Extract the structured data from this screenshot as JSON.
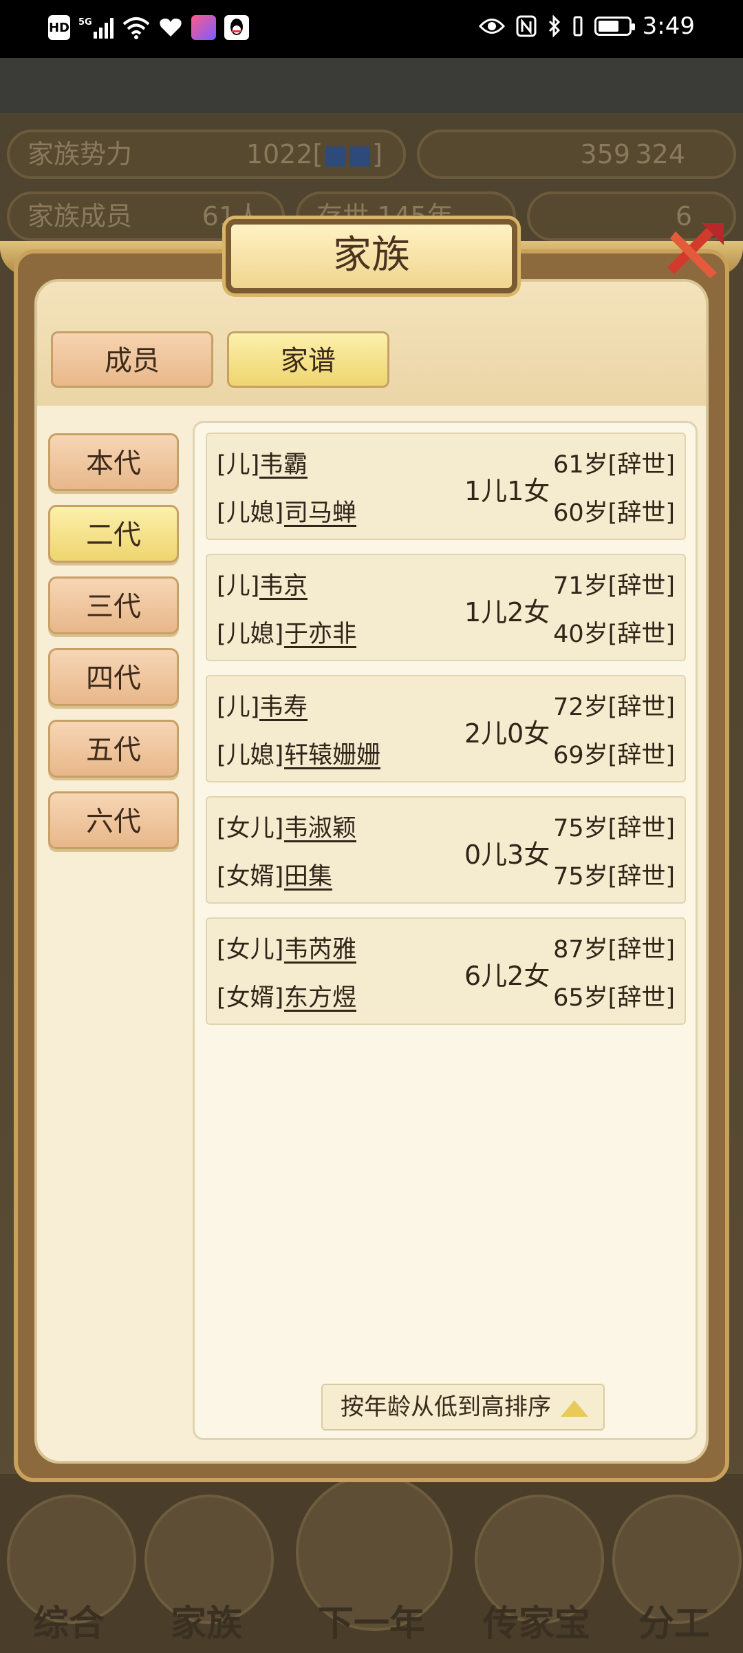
{
  "status_bar": {
    "left_icons": [
      "hd-icon",
      "signal-5g-icon",
      "wifi-icon",
      "heart-icon",
      "app-icon",
      "qq-icon"
    ],
    "hd_label": "HD",
    "net_label": "5G",
    "battery_level": 0.7,
    "time": "3:49"
  },
  "background_game": {
    "stat_power_label": "家族势力",
    "stat_power_value": "1022[",
    "stat_power_close": "]",
    "stat_resources": "359",
    "stat_resources2": "324",
    "stat_members_label": "家族成员",
    "stat_members_value": "61人",
    "stat_existence": "存世 145年",
    "stat_gold": "6",
    "nav_items": [
      "综合",
      "家族",
      "下一年",
      "传家宝",
      "分工"
    ]
  },
  "dialog": {
    "title": "家族",
    "tabs": [
      {
        "label": "成员",
        "active": false
      },
      {
        "label": "家谱",
        "active": true
      }
    ],
    "generations": [
      {
        "label": "本代",
        "active": false
      },
      {
        "label": "二代",
        "active": true
      },
      {
        "label": "三代",
        "active": false
      },
      {
        "label": "四代",
        "active": false
      },
      {
        "label": "五代",
        "active": false
      },
      {
        "label": "六代",
        "active": false
      }
    ],
    "families": [
      {
        "role1": "[儿]",
        "name1": "韦霸",
        "role2": "[儿媳]",
        "name2": "司马蝉",
        "children": "1儿1女",
        "age1": "61岁[辞世]",
        "age2": "60岁[辞世]"
      },
      {
        "role1": "[儿]",
        "name1": "韦京",
        "role2": "[儿媳]",
        "name2": "于亦非",
        "children": "1儿2女",
        "age1": "71岁[辞世]",
        "age2": "40岁[辞世]"
      },
      {
        "role1": "[儿]",
        "name1": "韦寿",
        "role2": "[儿媳]",
        "name2": "轩辕姗姗",
        "children": "2儿0女",
        "age1": "72岁[辞世]",
        "age2": "69岁[辞世]"
      },
      {
        "role1": "[女儿]",
        "name1": "韦淑颖",
        "role2": "[女婿]",
        "name2": "田集",
        "children": "0儿3女",
        "age1": "75岁[辞世]",
        "age2": "75岁[辞世]"
      },
      {
        "role1": "[女儿]",
        "name1": "韦芮雅",
        "role2": "[女婿]",
        "name2": "东方煜",
        "children": "6儿2女",
        "age1": "87岁[辞世]",
        "age2": "65岁[辞世]"
      }
    ],
    "sort_label": "按年龄从低到高排序"
  }
}
